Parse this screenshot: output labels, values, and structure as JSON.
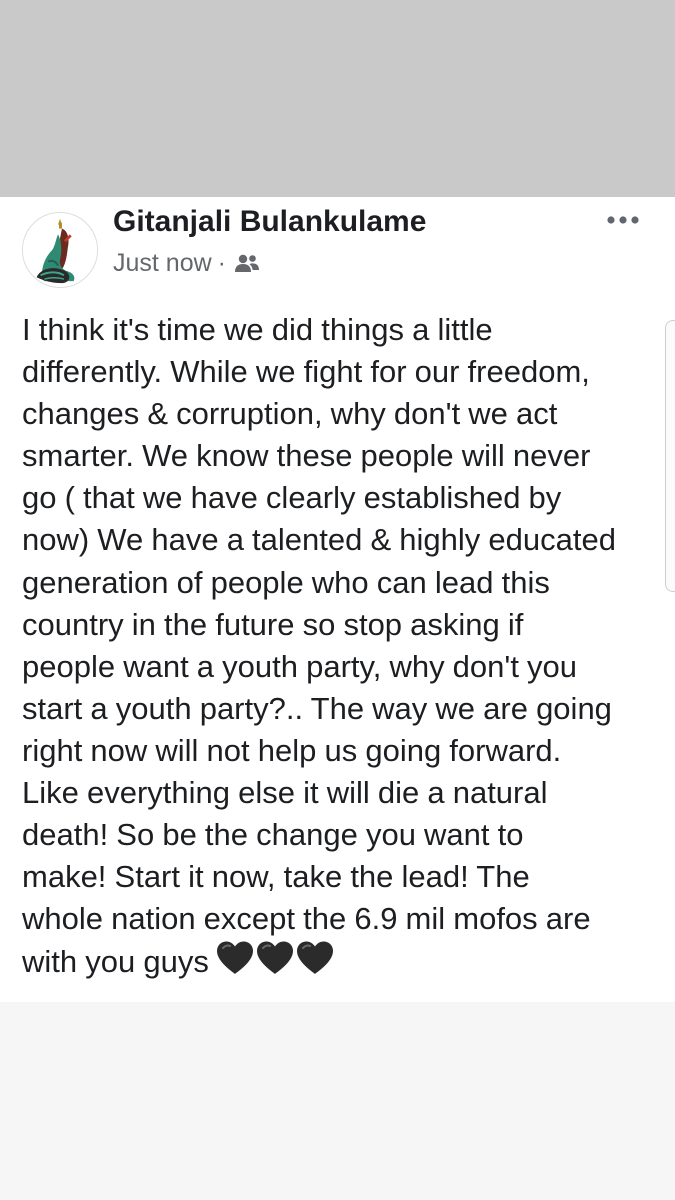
{
  "post": {
    "author": "Gitanjali Bulankulame",
    "timestamp": "Just now",
    "separator": "·",
    "audience_icon": "friends-icon",
    "more_icon": "more-options-icon",
    "body_text": "I think it's time we did things a little\ndifferently. While we fight for our freedom,\nchanges & corruption, why don't we act\nsmarter. We know these people will never\ngo ( that we have clearly established by\nnow) We have a talented & highly educated\ngeneration of people who can lead this\ncountry in the future so stop asking if\npeople want a youth party, why don't you\nstart a youth party?.. The way we are going\nright now will not help us going forward.\nLike everything else it will die a natural\ndeath!   So be the change you want to\nmake! Start it now, take the lead! The\nwhole nation except the 6.9 mil mofos are\nwith you guys",
    "emoji": [
      "black-heart-icon",
      "black-heart-icon",
      "black-heart-icon"
    ]
  },
  "colors": {
    "top_band": "#c9c9c9",
    "card": "#ffffff",
    "text": "#1c1e21",
    "secondary_text": "#65676b",
    "background": "#f7f7f7"
  }
}
